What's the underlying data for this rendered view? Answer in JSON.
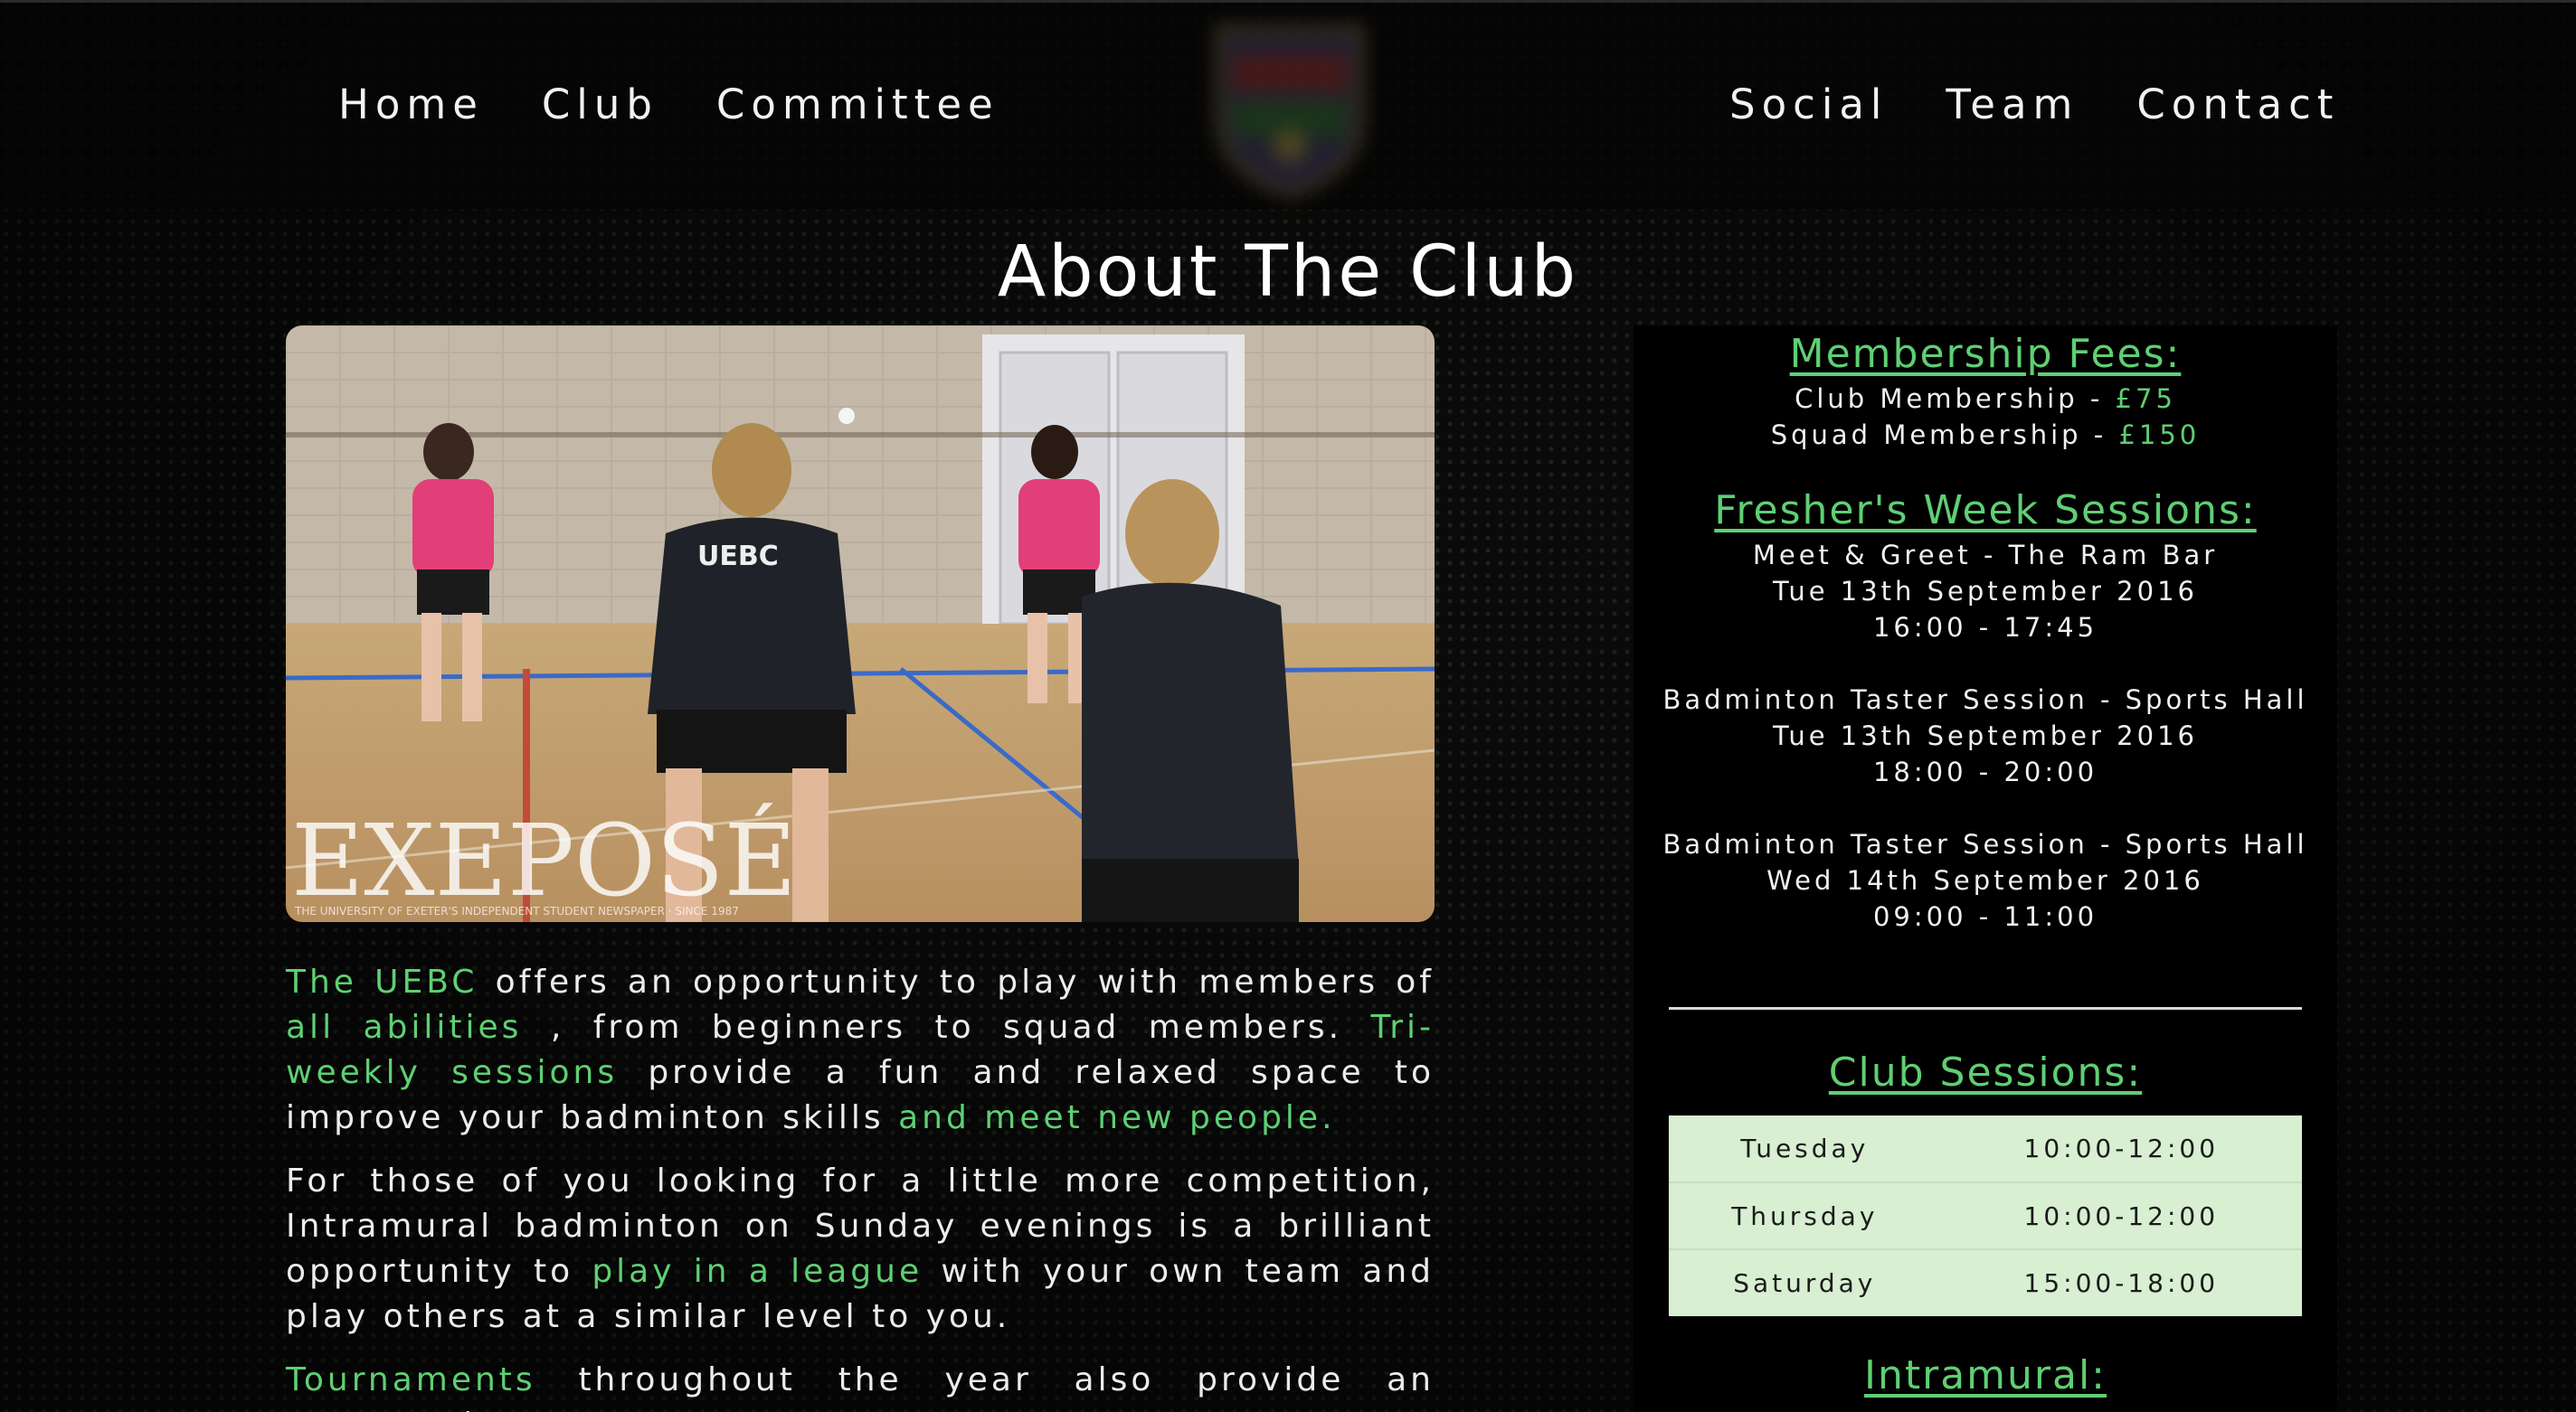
{
  "nav": {
    "left": [
      "Home",
      "Club",
      "Committee"
    ],
    "right": [
      "Social",
      "Team",
      "Contact"
    ]
  },
  "page": {
    "title": "About The Club"
  },
  "hero": {
    "watermark": "EXEPOSÉ",
    "watermark_sub": "THE UNIVERSITY OF EXETER'S INDEPENDENT STUDENT NEWSPAPER · SINCE 1987",
    "shirt_text": "UEBC"
  },
  "about": {
    "p1": [
      "The UEBC",
      " offers an opportunity to play with members of ",
      "all abilities",
      " , from beginners to squad members. ",
      "Tri-weekly sessions",
      " provide a fun and relaxed space to improve your badminton skills ",
      "and meet new people."
    ],
    "p2": [
      "For those of you looking for a little more competition, Intramural badminton on Sunday evenings is a brilliant opportunity to ",
      "play in a league",
      " with your own team and play others at a similar level to you."
    ],
    "p3": [
      "Tournaments",
      " throughout the year also provide an opportunity to"
    ]
  },
  "membership": {
    "heading": "Membership Fees:",
    "items": [
      {
        "label": "Club Membership - ",
        "price": "£75"
      },
      {
        "label": "Squad Membership - ",
        "price": "£150"
      }
    ]
  },
  "freshers": {
    "heading": "Fresher's Week Sessions:",
    "events": [
      {
        "title": "Meet & Greet - The Ram Bar",
        "date": "Tue 13th September 2016",
        "time": "16:00 - 17:45"
      },
      {
        "title": "Badminton Taster Session - Sports Hall",
        "date": "Tue 13th September 2016",
        "time": "18:00 - 20:00"
      },
      {
        "title": "Badminton Taster Session - Sports Hall",
        "date": "Wed 14th September 2016",
        "time": "09:00 - 11:00"
      }
    ]
  },
  "club_sessions": {
    "heading": "Club Sessions:",
    "rows": [
      {
        "day": "Tuesday",
        "time": "10:00-12:00"
      },
      {
        "day": "Thursday",
        "time": "10:00-12:00"
      },
      {
        "day": "Saturday",
        "time": "15:00-18:00"
      }
    ]
  },
  "intramural": {
    "heading": "Intramural:"
  },
  "colors": {
    "accent": "#5fcf73",
    "panel_bg": "#000000",
    "table_bg": "#d8efd2"
  }
}
